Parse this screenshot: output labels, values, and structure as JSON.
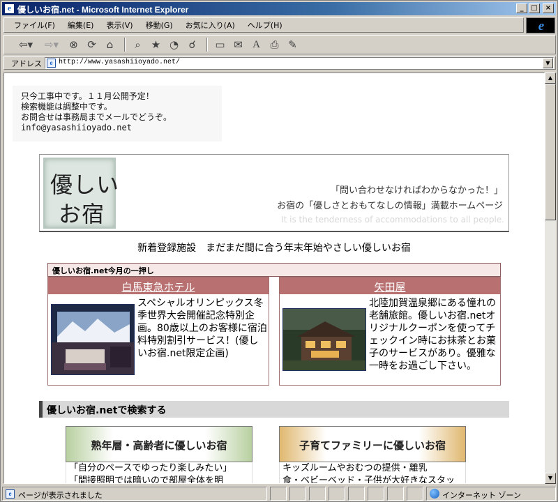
{
  "window": {
    "title": "優しいお宿.net - Microsoft Internet Explorer",
    "controls": [
      "_",
      "□",
      "×"
    ]
  },
  "menubar": {
    "items": [
      "ファイル(F)",
      "編集(E)",
      "表示(V)",
      "移動(G)",
      "お気に入り(A)",
      "ヘルプ(H)"
    ]
  },
  "toolbar": {
    "icons": [
      "back-icon",
      "forward-icon",
      "stop-icon",
      "refresh-icon",
      "home-icon",
      "search-icon",
      "favorites-icon",
      "history-icon",
      "channels-icon",
      "fullscreen-icon",
      "mail-icon",
      "font-icon",
      "print-icon",
      "edit-icon"
    ]
  },
  "address": {
    "label": "アドレス",
    "url": "http://www.yasashiioyado.net/"
  },
  "notice": {
    "lines": [
      "只今工事中です。１１月公開予定！",
      "検索機能は調整中です。",
      "お問合せは事務局までメールでどうぞ。",
      "info@yasashiioyado.net"
    ]
  },
  "header": {
    "logo_line1": "優しい",
    "logo_line2": "お宿",
    "tagline1": "「問い合わせなければわからなかった！」",
    "tagline2": "お宿の「優しさとおもてなしの情報」満載ホームページ",
    "tagline3": "It is the tenderness of accommodations to all people."
  },
  "new_listing": "新着登録施設　まだまだ間に合う年末年始やさしい優しいお宿",
  "monthly_pick": {
    "heading": "優しいお宿.net今月の一押し",
    "cards": [
      {
        "name": "白馬東急ホテル",
        "text": "スペシャルオリンピックス冬季世界大会開催記念特別企画。80歳以上のお客様に宿泊料特別割引サービス！(優しいお宿.net限定企画)"
      },
      {
        "name": "矢田屋",
        "text": "北陸加賀温泉郷にある憧れの老舗旅館。優しいお宿.netオリジナルクーポンを使ってチェックイン時にお抹茶とお菓子のサービスがあり。優雅な一時をお過ごし下さい。"
      }
    ]
  },
  "search": {
    "heading": "優しいお宿.netで検索する",
    "categories": [
      {
        "label": "熟年層・高齢者に優しいお宿",
        "desc1": "「自分のペースでゆったり楽しみたい」",
        "desc2": "「間接照明では暗いので部屋全体を明"
      },
      {
        "label": "子育てファミリーに優しいお宿",
        "desc1": "キッズルームやおむつの提供・離乳",
        "desc2": "食・ベビーベッド・子供が大好きなスタッ"
      }
    ]
  },
  "statusbar": {
    "text": "ページが表示されました",
    "zone": "インターネット ゾーン"
  }
}
